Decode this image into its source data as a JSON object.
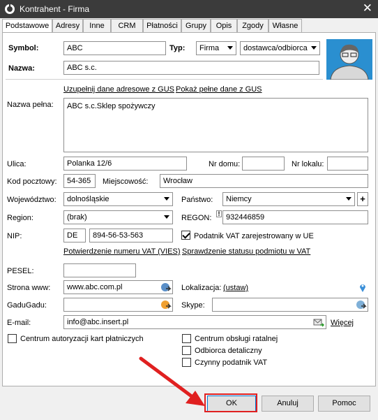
{
  "window": {
    "title": "Kontrahent - Firma",
    "close_label": "✕"
  },
  "tabs": [
    "Podstawowe",
    "Adresy",
    "Inne",
    "CRM",
    "Płatności",
    "Grupy",
    "Opis",
    "Zgody",
    "Własne"
  ],
  "form": {
    "symbol_label": "Symbol:",
    "symbol_value": "ABC",
    "typ_label": "Typ:",
    "typ_value": "Firma",
    "typ2_value": "dostawca/odbiorca",
    "nazwa_label": "Nazwa:",
    "nazwa_value": "ABC s.c.",
    "gus_link": "Uzupełnij dane adresowe z GUS",
    "gus_full_link": "Pokaż pełne dane z GUS",
    "nazwa_pelna_label": "Nazwa pełna:",
    "nazwa_pelna_value": "ABC s.c.Sklep spożywczy",
    "ulica_label": "Ulica:",
    "ulica_value": "Polanka  12/6",
    "nr_domu_label": "Nr domu:",
    "nr_domu_value": "",
    "nr_lokalu_label": "Nr lokalu:",
    "nr_lokalu_value": "",
    "kod_label": "Kod pocztowy:",
    "kod_value": "54-365",
    "miejscowosc_label": "Miejscowość:",
    "miejscowosc_value": "Wrocław",
    "wojewodztwo_label": "Województwo:",
    "wojewodztwo_value": "dolnośląskie",
    "panstwo_label": "Państwo:",
    "panstwo_value": "Niemcy",
    "panstwo_add": "+",
    "region_label": "Region:",
    "region_value": "(brak)",
    "regon_label": "REGON:",
    "regon_value": "932446859",
    "regon_warn": "!",
    "nip_label": "NIP:",
    "nip_prefix": "DE",
    "nip_value": "894-56-53-563",
    "vat_ue_label": "Podatnik VAT zarejestrowany w UE",
    "vies_link": "Potwierdzenie numeru VAT (VIES)",
    "vat_status_link": "Sprawdzenie statusu podmiotu w VAT",
    "pesel_label": "PESEL:",
    "pesel_value": "",
    "www_label": "Strona www:",
    "www_value": "www.abc.com.pl",
    "lokalizacja_label": "Lokalizacja:",
    "lokalizacja_link": "(ustaw)",
    "gadugadu_label": "GaduGadu:",
    "gadugadu_value": "",
    "skype_label": "Skype:",
    "skype_value": "",
    "email_label": "E-mail:",
    "email_value": "info@abc.insert.pl",
    "wiecej_link": "Więcej",
    "centrum_aut_label": "Centrum autoryzacji kart płatniczych",
    "centrum_obslugi_label": "Centrum obsługi ratalnej",
    "odbiorca_label": "Odbiorca detaliczny",
    "czynny_label": "Czynny podatnik VAT"
  },
  "buttons": {
    "ok": "OK",
    "cancel": "Anuluj",
    "help": "Pomoc"
  },
  "colors": {
    "titlebar": "#3b3b3b",
    "highlight": "#e02020"
  }
}
